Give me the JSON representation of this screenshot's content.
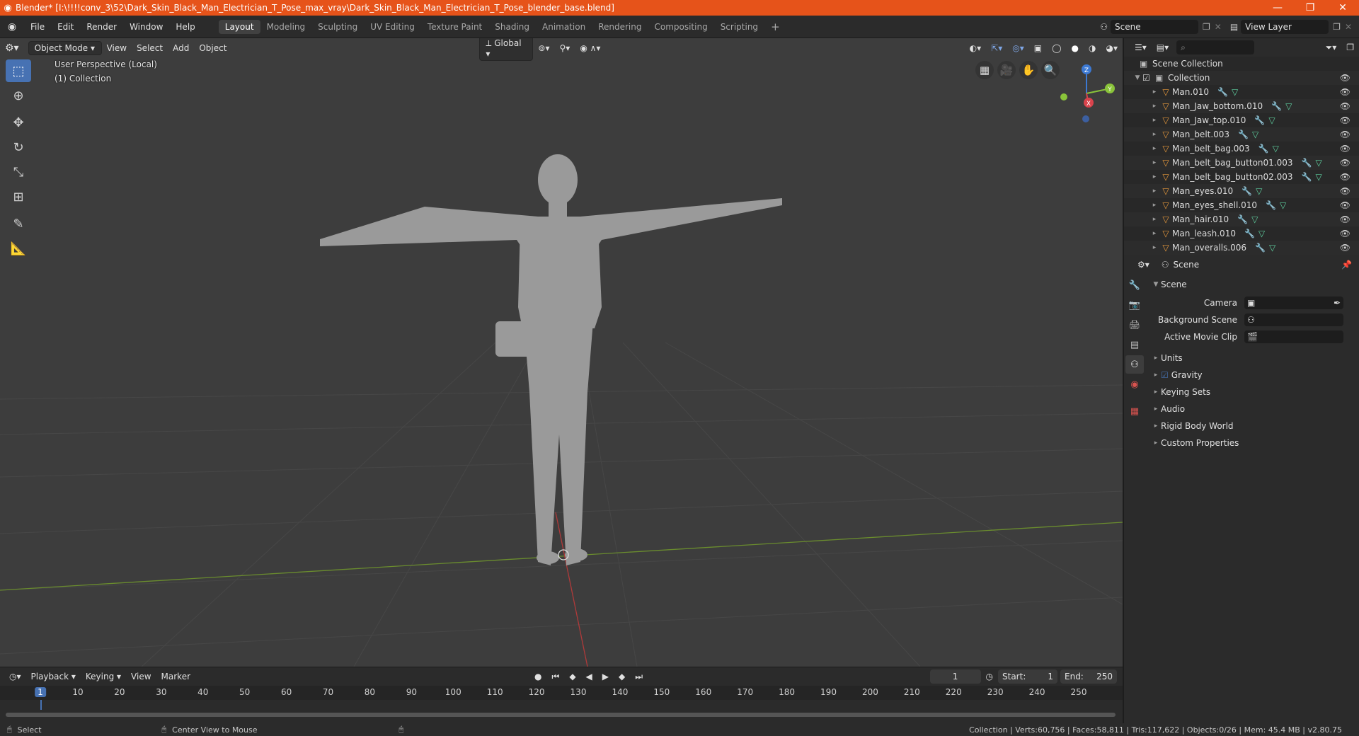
{
  "window": {
    "title": "Blender* [I:\\!!!!conv_3\\52\\Dark_Skin_Black_Man_Electrician_T_Pose_max_vray\\Dark_Skin_Black_Man_Electrician_T_Pose_blender_base.blend]"
  },
  "menu": [
    "File",
    "Edit",
    "Render",
    "Window",
    "Help"
  ],
  "workspaces": [
    "Layout",
    "Modeling",
    "Sculpting",
    "UV Editing",
    "Texture Paint",
    "Shading",
    "Animation",
    "Rendering",
    "Compositing",
    "Scripting"
  ],
  "active_workspace": "Layout",
  "scene_field": "Scene",
  "view_layer_field": "View Layer",
  "viewport": {
    "mode": "Object Mode",
    "menus": [
      "View",
      "Select",
      "Add",
      "Object"
    ],
    "orientation": "Global",
    "overlay_line1": "User Perspective (Local)",
    "overlay_line2": "(1) Collection",
    "gizmo": {
      "z": "Z",
      "y": "Y",
      "x": "X"
    }
  },
  "timeline": {
    "menus": [
      "Playback",
      "Keying",
      "View",
      "Marker"
    ],
    "current_frame": "1",
    "start_label": "Start:",
    "start": "1",
    "end_label": "End:",
    "end": "250",
    "ruler": [
      "1",
      "10",
      "20",
      "30",
      "40",
      "50",
      "60",
      "70",
      "80",
      "90",
      "100",
      "110",
      "120",
      "130",
      "140",
      "150",
      "160",
      "170",
      "180",
      "190",
      "200",
      "210",
      "220",
      "230",
      "240",
      "250"
    ]
  },
  "status": {
    "left": "Select",
    "middle": "Center View to Mouse",
    "right": "Collection | Verts:60,756 | Faces:58,811 | Tris:117,622 | Objects:0/26 | Mem: 45.4 MB | v2.80.75"
  },
  "outliner": {
    "root": "Scene Collection",
    "collection": "Collection",
    "items": [
      "Man.010",
      "Man_Jaw_bottom.010",
      "Man_Jaw_top.010",
      "Man_belt.003",
      "Man_belt_bag.003",
      "Man_belt_bag_button01.003",
      "Man_belt_bag_button02.003",
      "Man_eyes.010",
      "Man_eyes_shell.010",
      "Man_hair.010",
      "Man_leash.010",
      "Man_overalls.006"
    ]
  },
  "properties": {
    "context": "Scene",
    "panel": "Scene",
    "camera_label": "Camera",
    "background_label": "Background Scene",
    "movieclip_label": "Active Movie Clip",
    "subpanels": [
      "Units",
      "Gravity",
      "Keying Sets",
      "Audio",
      "Rigid Body World",
      "Custom Properties"
    ]
  }
}
